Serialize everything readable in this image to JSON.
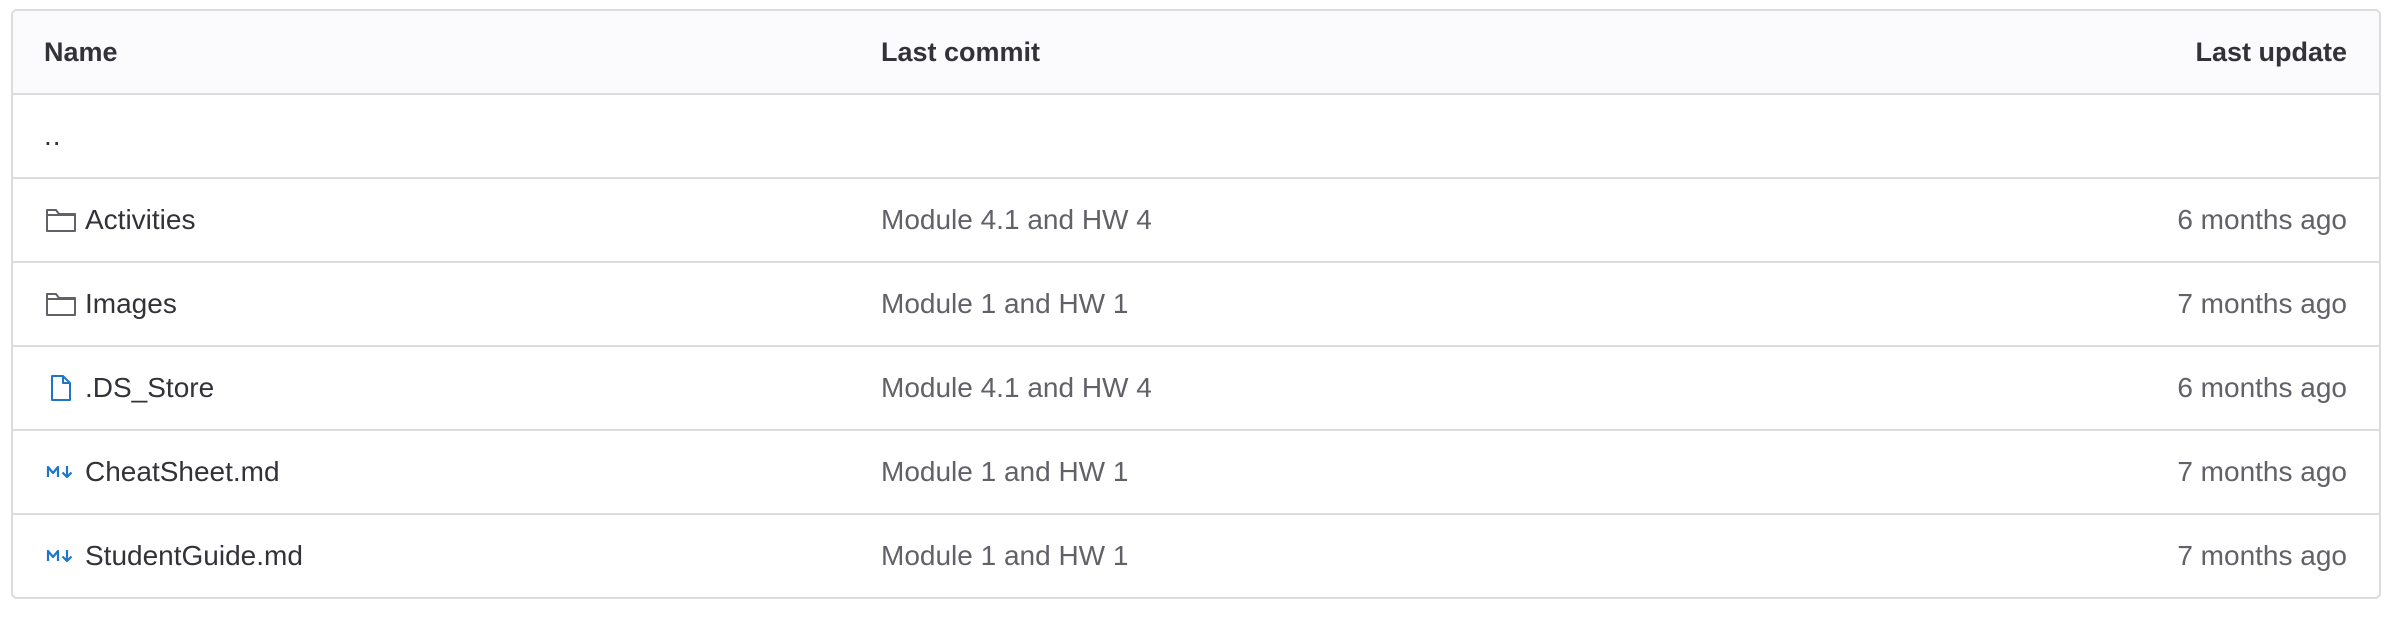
{
  "table": {
    "headers": {
      "name": "Name",
      "last_commit": "Last commit",
      "last_update": "Last update"
    },
    "parent_link": "..",
    "rows": [
      {
        "name": "Activities",
        "type": "folder",
        "icon": "folder-icon",
        "commit": "Module 4.1 and HW 4",
        "updated": "6 months ago"
      },
      {
        "name": "Images",
        "type": "folder",
        "icon": "folder-icon",
        "commit": "Module 1 and HW 1",
        "updated": "7 months ago"
      },
      {
        "name": ".DS_Store",
        "type": "file",
        "icon": "file-icon",
        "commit": "Module 4.1 and HW 4",
        "updated": "6 months ago"
      },
      {
        "name": "CheatSheet.md",
        "type": "markdown",
        "icon": "markdown-icon",
        "commit": "Module 1 and HW 1",
        "updated": "7 months ago"
      },
      {
        "name": "StudentGuide.md",
        "type": "markdown",
        "icon": "markdown-icon",
        "commit": "Module 1 and HW 1",
        "updated": "7 months ago"
      }
    ]
  },
  "colors": {
    "text": "#333238",
    "muted": "#626168",
    "border": "#dcdcde",
    "header_bg": "#fbfafd",
    "file_icon": "#1f75cb"
  }
}
